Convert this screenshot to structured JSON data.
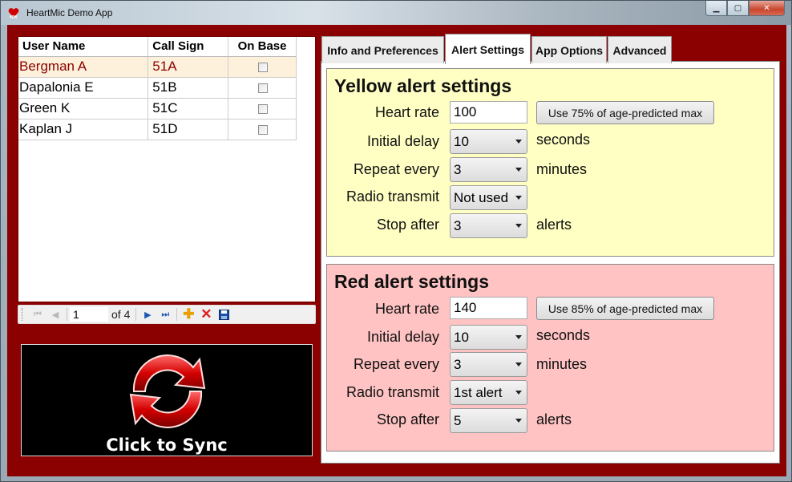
{
  "window": {
    "title": "HeartMic Demo App",
    "accent": "#8b0000"
  },
  "grid": {
    "columns": [
      "User Name",
      "Call Sign",
      "On Base"
    ],
    "rows": [
      {
        "name": "Bergman A",
        "call_sign": "51A",
        "on_base": false,
        "selected": true
      },
      {
        "name": "Dapalonia E",
        "call_sign": "51B",
        "on_base": false,
        "selected": false
      },
      {
        "name": "Green K",
        "call_sign": "51C",
        "on_base": false,
        "selected": false
      },
      {
        "name": "Kaplan J",
        "call_sign": "51D",
        "on_base": false,
        "selected": false
      }
    ]
  },
  "navigator": {
    "position": "1",
    "count_text": "of 4"
  },
  "sync": {
    "label": "Click to Sync"
  },
  "tabs": [
    {
      "label": "Info and Preferences",
      "active": false
    },
    {
      "label": "Alert Settings",
      "active": true
    },
    {
      "label": "App Options",
      "active": false
    },
    {
      "label": "Advanced",
      "active": false
    }
  ],
  "yellow": {
    "title": "Yellow alert settings",
    "heart_rate_label": "Heart rate",
    "heart_rate": "100",
    "age_button": "Use 75% of age-predicted max",
    "initial_delay_label": "Initial delay",
    "initial_delay": "10",
    "initial_delay_unit": "seconds",
    "repeat_label": "Repeat every",
    "repeat": "3",
    "repeat_unit": "minutes",
    "radio_label": "Radio transmit",
    "radio": "Not used",
    "stop_label": "Stop after",
    "stop": "3",
    "stop_unit": "alerts",
    "color": "#ffffc4"
  },
  "red": {
    "title": "Red alert settings",
    "heart_rate_label": "Heart rate",
    "heart_rate": "140",
    "age_button": "Use 85% of age-predicted max",
    "initial_delay_label": "Initial delay",
    "initial_delay": "10",
    "initial_delay_unit": "seconds",
    "repeat_label": "Repeat every",
    "repeat": "3",
    "repeat_unit": "minutes",
    "radio_label": "Radio transmit",
    "radio": "1st alert",
    "stop_label": "Stop after",
    "stop": "5",
    "stop_unit": "alerts",
    "color": "#ffc3c3"
  }
}
